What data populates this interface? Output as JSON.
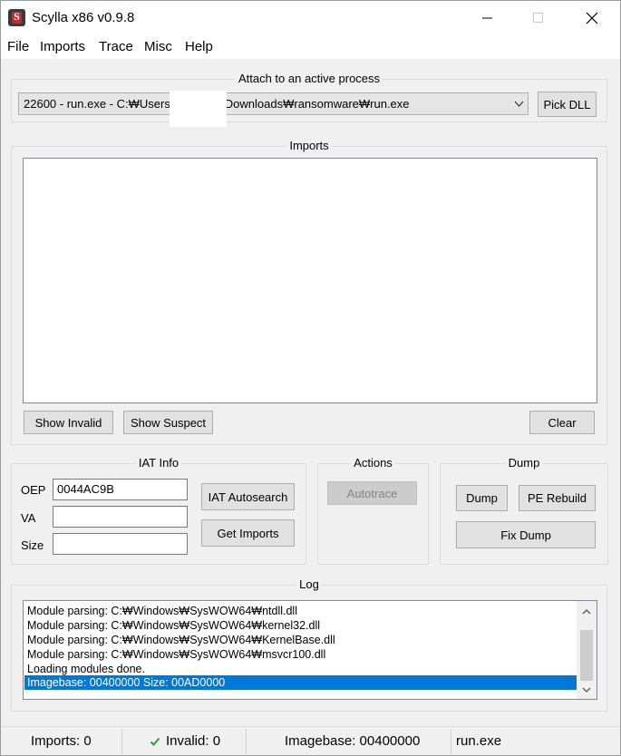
{
  "window": {
    "title": "Scylla x86 v0.9.8",
    "app_icon_letter": "S",
    "minimize_icon": "minimize-icon",
    "maximize_icon": "maximize-icon",
    "close_icon": "close-icon"
  },
  "menu": [
    "File",
    "Imports",
    "Trace",
    "Misc",
    "Help"
  ],
  "attach": {
    "label": "Attach to an active process",
    "process_selected": "22600 - run.exe - C:₩Users₩dmodi₩Downloads₩ransomware₩run.exe",
    "pick_dll": "Pick DLL"
  },
  "imports": {
    "label": "Imports",
    "show_invalid": "Show Invalid",
    "show_suspect": "Show Suspect",
    "clear": "Clear"
  },
  "iat_info": {
    "label": "IAT Info",
    "oep_label": "OEP",
    "oep_value": "0044AC9B",
    "va_label": "VA",
    "va_value": "",
    "size_label": "Size",
    "size_value": "",
    "autosearch": "IAT Autosearch",
    "get_imports": "Get Imports"
  },
  "actions": {
    "label": "Actions",
    "autotrace": "Autotrace"
  },
  "dump": {
    "label": "Dump",
    "dump": "Dump",
    "pe_rebuild": "PE Rebuild",
    "fix_dump": "Fix Dump"
  },
  "log": {
    "label": "Log",
    "lines": [
      "Module parsing: C:₩Windows₩SysWOW64₩ntdll.dll",
      "Module parsing: C:₩Windows₩SysWOW64₩kernel32.dll",
      "Module parsing: C:₩Windows₩SysWOW64₩KernelBase.dll",
      "Module parsing: C:₩Windows₩SysWOW64₩msvcr100.dll",
      "Loading modules done.",
      "Imagebase: 00400000 Size: 00AD0000"
    ],
    "selected_index": 5
  },
  "status": {
    "imports": "Imports: 0",
    "invalid_icon": "checkmark-icon",
    "invalid": "Invalid: 0",
    "imagebase": "Imagebase: 00400000",
    "module": "run.exe"
  },
  "colors": {
    "selection": "#0078d7",
    "check": "#2e9b3a",
    "window_bg": "#f0f0f0"
  }
}
